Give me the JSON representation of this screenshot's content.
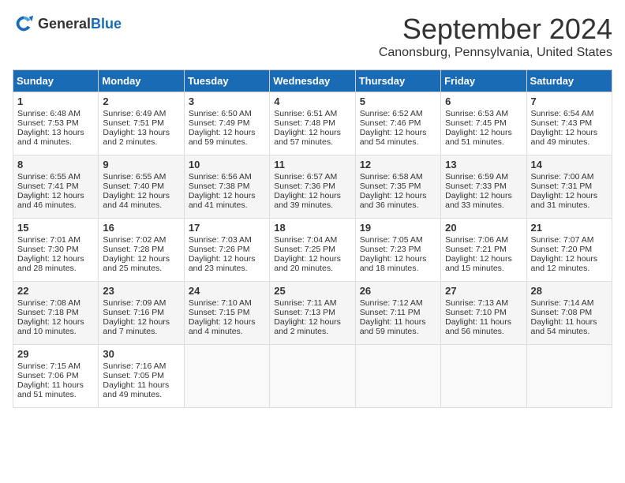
{
  "header": {
    "logo_general": "General",
    "logo_blue": "Blue",
    "title": "September 2024",
    "location": "Canonsburg, Pennsylvania, United States"
  },
  "weekdays": [
    "Sunday",
    "Monday",
    "Tuesday",
    "Wednesday",
    "Thursday",
    "Friday",
    "Saturday"
  ],
  "weeks": [
    [
      {
        "day": "1",
        "sunrise": "6:48 AM",
        "sunset": "7:53 PM",
        "daylight": "13 hours and 4 minutes."
      },
      {
        "day": "2",
        "sunrise": "6:49 AM",
        "sunset": "7:51 PM",
        "daylight": "13 hours and 2 minutes."
      },
      {
        "day": "3",
        "sunrise": "6:50 AM",
        "sunset": "7:49 PM",
        "daylight": "12 hours and 59 minutes."
      },
      {
        "day": "4",
        "sunrise": "6:51 AM",
        "sunset": "7:48 PM",
        "daylight": "12 hours and 57 minutes."
      },
      {
        "day": "5",
        "sunrise": "6:52 AM",
        "sunset": "7:46 PM",
        "daylight": "12 hours and 54 minutes."
      },
      {
        "day": "6",
        "sunrise": "6:53 AM",
        "sunset": "7:45 PM",
        "daylight": "12 hours and 51 minutes."
      },
      {
        "day": "7",
        "sunrise": "6:54 AM",
        "sunset": "7:43 PM",
        "daylight": "12 hours and 49 minutes."
      }
    ],
    [
      {
        "day": "8",
        "sunrise": "6:55 AM",
        "sunset": "7:41 PM",
        "daylight": "12 hours and 46 minutes."
      },
      {
        "day": "9",
        "sunrise": "6:55 AM",
        "sunset": "7:40 PM",
        "daylight": "12 hours and 44 minutes."
      },
      {
        "day": "10",
        "sunrise": "6:56 AM",
        "sunset": "7:38 PM",
        "daylight": "12 hours and 41 minutes."
      },
      {
        "day": "11",
        "sunrise": "6:57 AM",
        "sunset": "7:36 PM",
        "daylight": "12 hours and 39 minutes."
      },
      {
        "day": "12",
        "sunrise": "6:58 AM",
        "sunset": "7:35 PM",
        "daylight": "12 hours and 36 minutes."
      },
      {
        "day": "13",
        "sunrise": "6:59 AM",
        "sunset": "7:33 PM",
        "daylight": "12 hours and 33 minutes."
      },
      {
        "day": "14",
        "sunrise": "7:00 AM",
        "sunset": "7:31 PM",
        "daylight": "12 hours and 31 minutes."
      }
    ],
    [
      {
        "day": "15",
        "sunrise": "7:01 AM",
        "sunset": "7:30 PM",
        "daylight": "12 hours and 28 minutes."
      },
      {
        "day": "16",
        "sunrise": "7:02 AM",
        "sunset": "7:28 PM",
        "daylight": "12 hours and 25 minutes."
      },
      {
        "day": "17",
        "sunrise": "7:03 AM",
        "sunset": "7:26 PM",
        "daylight": "12 hours and 23 minutes."
      },
      {
        "day": "18",
        "sunrise": "7:04 AM",
        "sunset": "7:25 PM",
        "daylight": "12 hours and 20 minutes."
      },
      {
        "day": "19",
        "sunrise": "7:05 AM",
        "sunset": "7:23 PM",
        "daylight": "12 hours and 18 minutes."
      },
      {
        "day": "20",
        "sunrise": "7:06 AM",
        "sunset": "7:21 PM",
        "daylight": "12 hours and 15 minutes."
      },
      {
        "day": "21",
        "sunrise": "7:07 AM",
        "sunset": "7:20 PM",
        "daylight": "12 hours and 12 minutes."
      }
    ],
    [
      {
        "day": "22",
        "sunrise": "7:08 AM",
        "sunset": "7:18 PM",
        "daylight": "12 hours and 10 minutes."
      },
      {
        "day": "23",
        "sunrise": "7:09 AM",
        "sunset": "7:16 PM",
        "daylight": "12 hours and 7 minutes."
      },
      {
        "day": "24",
        "sunrise": "7:10 AM",
        "sunset": "7:15 PM",
        "daylight": "12 hours and 4 minutes."
      },
      {
        "day": "25",
        "sunrise": "7:11 AM",
        "sunset": "7:13 PM",
        "daylight": "12 hours and 2 minutes."
      },
      {
        "day": "26",
        "sunrise": "7:12 AM",
        "sunset": "7:11 PM",
        "daylight": "11 hours and 59 minutes."
      },
      {
        "day": "27",
        "sunrise": "7:13 AM",
        "sunset": "7:10 PM",
        "daylight": "11 hours and 56 minutes."
      },
      {
        "day": "28",
        "sunrise": "7:14 AM",
        "sunset": "7:08 PM",
        "daylight": "11 hours and 54 minutes."
      }
    ],
    [
      {
        "day": "29",
        "sunrise": "7:15 AM",
        "sunset": "7:06 PM",
        "daylight": "11 hours and 51 minutes."
      },
      {
        "day": "30",
        "sunrise": "7:16 AM",
        "sunset": "7:05 PM",
        "daylight": "11 hours and 49 minutes."
      },
      null,
      null,
      null,
      null,
      null
    ]
  ],
  "labels": {
    "sunrise": "Sunrise:",
    "sunset": "Sunset:",
    "daylight": "Daylight:"
  }
}
